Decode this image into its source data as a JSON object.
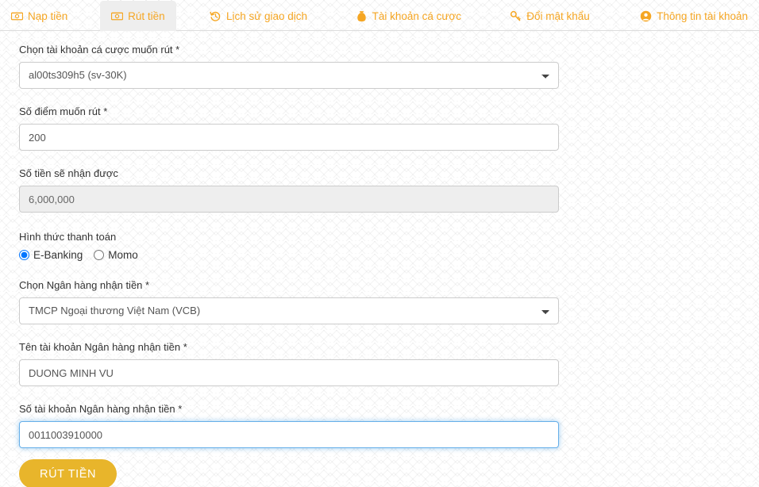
{
  "tabs": [
    {
      "label": "Nạp tiền",
      "icon": "banknote-icon",
      "active": false
    },
    {
      "label": "Rút tiền",
      "icon": "banknote-icon",
      "active": true
    },
    {
      "label": "Lịch sử giao dịch",
      "icon": "history-icon",
      "active": false
    },
    {
      "label": "Tài khoản cá cược",
      "icon": "money-bag-icon",
      "active": false
    },
    {
      "label": "Đổi mật khẩu",
      "icon": "key-icon",
      "active": false
    },
    {
      "label": "Thông tin tài khoản",
      "icon": "user-circle-icon",
      "active": false
    }
  ],
  "form": {
    "betting_account": {
      "label": "Chọn tài khoản cá cược muốn rút *",
      "value": "al00ts309h5 (sv-30K)"
    },
    "points": {
      "label": "Số điểm muốn rút *",
      "value": "200"
    },
    "amount_received": {
      "label": "Số tiền sẽ nhận được",
      "value": "6,000,000"
    },
    "payment_method": {
      "label": "Hình thức thanh toán",
      "options": [
        {
          "label": "E-Banking",
          "selected": true
        },
        {
          "label": "Momo",
          "selected": false
        }
      ]
    },
    "bank": {
      "label": "Chọn Ngân hàng nhận tiền *",
      "value": "TMCP Ngoại thương Việt Nam (VCB)"
    },
    "bank_account_name": {
      "label": "Tên tài khoản Ngân hàng nhận tiền *",
      "value": "DUONG MINH VU"
    },
    "bank_account_number": {
      "label": "Số tài khoản Ngân hàng nhận tiền *",
      "value": "0011003910000"
    },
    "submit_label": "RÚT TIỀN"
  },
  "colors": {
    "accent": "#f5a623",
    "button": "#e8b52b",
    "focus": "#66afe9"
  }
}
